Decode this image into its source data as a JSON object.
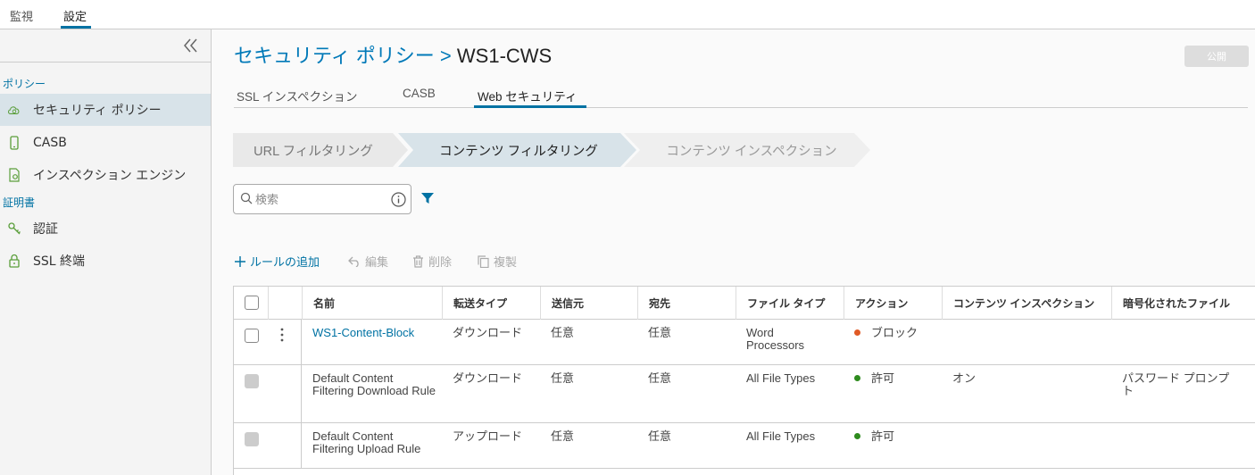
{
  "top_tabs": [
    "監視",
    "設定"
  ],
  "sidebar": {
    "sections": [
      {
        "title": "ポリシー",
        "items": [
          {
            "label": "セキュリティ ポリシー",
            "icon": "cloud-shield-icon",
            "active": true
          },
          {
            "label": "CASB",
            "icon": "mobile-device-icon"
          },
          {
            "label": "インスペクション エンジン",
            "icon": "document-gear-icon"
          }
        ]
      },
      {
        "title": "証明書",
        "items": [
          {
            "label": "認証",
            "icon": "key-icon"
          },
          {
            "label": "SSL 終端",
            "icon": "lock-icon"
          }
        ]
      }
    ]
  },
  "header": {
    "breadcrumb": "セキュリティ ポリシー",
    "separator": ">",
    "current": "WS1-CWS",
    "publish_label": "公開"
  },
  "subtabs": [
    "SSL インスペクション",
    "CASB",
    "Web セキュリティ"
  ],
  "steps": [
    {
      "label": "URL フィルタリング",
      "state": "inactive"
    },
    {
      "label": "コンテンツ フィルタリング",
      "state": "active"
    },
    {
      "label": "コンテンツ インスペクション",
      "state": "disabled"
    }
  ],
  "search": {
    "placeholder": "検索"
  },
  "actions": {
    "add": "ルールの追加",
    "edit": "編集",
    "delete": "削除",
    "copy": "複製"
  },
  "table": {
    "columns": [
      "名前",
      "転送タイプ",
      "送信元",
      "宛先",
      "ファイル タイプ",
      "アクション",
      "コンテンツ インスペクション",
      "暗号化されたファイル"
    ],
    "rows": [
      {
        "name": "WS1-Content-Block",
        "transfer": "ダウンロード",
        "source": "任意",
        "dest": "任意",
        "filetype": "Word Processors",
        "action": "ブロック",
        "action_color": "#e05a25",
        "inspection": "",
        "encrypted": ""
      },
      {
        "name": "Default Content Filtering Download Rule",
        "transfer": "ダウンロード",
        "source": "任意",
        "dest": "任意",
        "filetype": "All File Types",
        "action": "許可",
        "action_color": "#2e8b1e",
        "inspection": "オン",
        "encrypted": "パスワード プロンプト"
      },
      {
        "name": "Default Content Filtering Upload Rule",
        "transfer": "アップロード",
        "source": "任意",
        "dest": "任意",
        "filetype": "All File Types",
        "action": "許可",
        "action_color": "#2e8b1e",
        "inspection": "",
        "encrypted": ""
      }
    ]
  },
  "colors": {
    "accent": "#0072a3",
    "active_bg": "#d8e3e9"
  }
}
